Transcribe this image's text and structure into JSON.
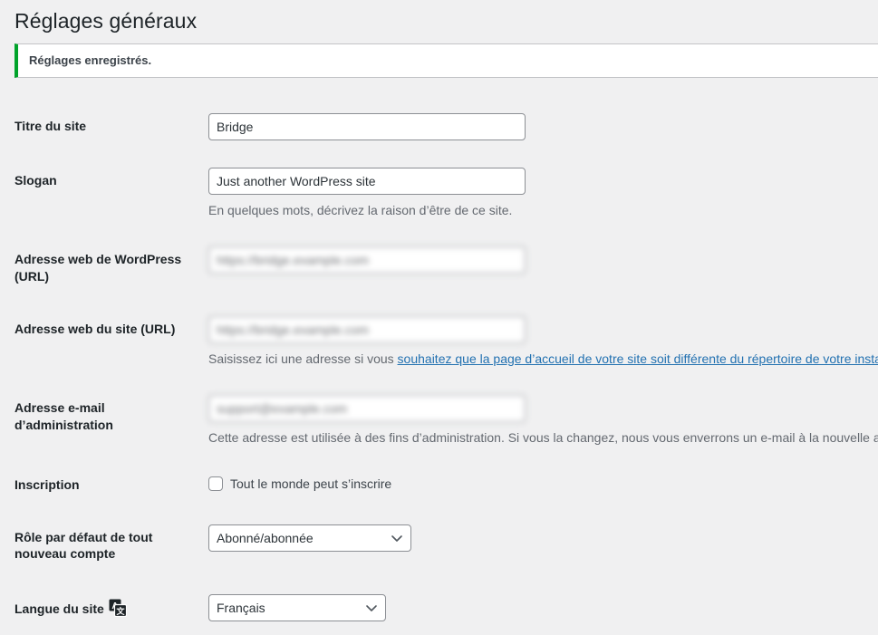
{
  "page": {
    "title": "Réglages généraux"
  },
  "notice": {
    "message": "Réglages enregistrés.",
    "accent_color": "#00a32a"
  },
  "fields": {
    "site_title": {
      "label": "Titre du site",
      "value": "Bridge"
    },
    "tagline": {
      "label": "Slogan",
      "value": "Just another WordPress site",
      "description": "En quelques mots, décrivez la raison d’être de ce site."
    },
    "wordpress_url": {
      "label": "Adresse web de WordPress (URL)",
      "value": "https://bridge.example.com",
      "redacted": true
    },
    "site_url": {
      "label": "Adresse web du site (URL)",
      "value": "https://bridge.example.com",
      "redacted": true,
      "description_before": "Saisissez ici une adresse si vous ",
      "description_link": "souhaitez que la page d’accueil de votre site soit différente du répertoire de votre insta"
    },
    "admin_email": {
      "label": "Adresse e-mail d’administration",
      "value": "support@example.com",
      "redacted": true,
      "description": "Cette adresse est utilisée à des fins d’administration. Si vous la changez, nous vous enverrons un e-mail à la nouvelle ad"
    },
    "membership": {
      "label": "Inscription",
      "checkbox_label": "Tout le monde peut s’inscrire",
      "checked": false
    },
    "default_role": {
      "label": "Rôle par défaut de tout nouveau compte",
      "value": "Abonné/abonnée",
      "options": [
        "Abonné/abonnée"
      ]
    },
    "site_language": {
      "label": "Langue du site",
      "icon": "translation-icon",
      "value": "Français",
      "options": [
        "Français"
      ]
    }
  }
}
